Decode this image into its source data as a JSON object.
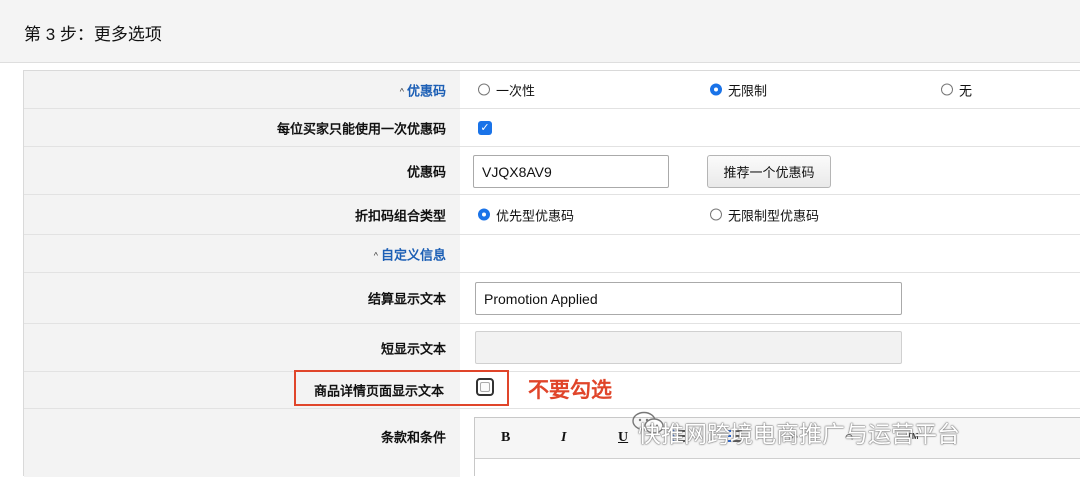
{
  "step": {
    "title": "第 3 步：更多选项"
  },
  "rows": {
    "coupon_code": {
      "label": "优惠码",
      "options": [
        "一次性",
        "无限制",
        "无"
      ],
      "selected": "无限制"
    },
    "one_per_buyer": {
      "label": "每位买家只能使用一次优惠码",
      "checked": true
    },
    "code_value": {
      "label": "优惠码",
      "value": "VJQX8AV9",
      "suggest_button": "推荐一个优惠码"
    },
    "combo_type": {
      "label": "折扣码组合类型",
      "options": [
        "优先型优惠码",
        "无限制型优惠码"
      ],
      "selected": "优先型优惠码"
    },
    "custom_info": {
      "label": "自定义信息"
    },
    "checkout_text": {
      "label": "结算显示文本",
      "value": "Promotion Applied"
    },
    "short_text": {
      "label": "短显示文本",
      "value": ""
    },
    "detail_page_text": {
      "label": "商品详情页面显示文本",
      "checked": false
    },
    "terms": {
      "label": "条款和条件"
    }
  },
  "annotation": {
    "text": "不要勾选",
    "color": "#e0452a"
  },
  "editor": {
    "tools": [
      "B",
      "I",
      "U"
    ],
    "tool_icons": [
      "list-bullets-icon",
      "list-numbers-icon",
      "undo-icon",
      "redo-icon",
      "trademark-icon"
    ]
  },
  "watermark": {
    "text": "快推网跨境电商推广与运营平台",
    "icon": "wechat-icon"
  },
  "colors": {
    "accent": "#1a73e8",
    "link": "#1c5fb5",
    "warning": "#e0452a"
  }
}
